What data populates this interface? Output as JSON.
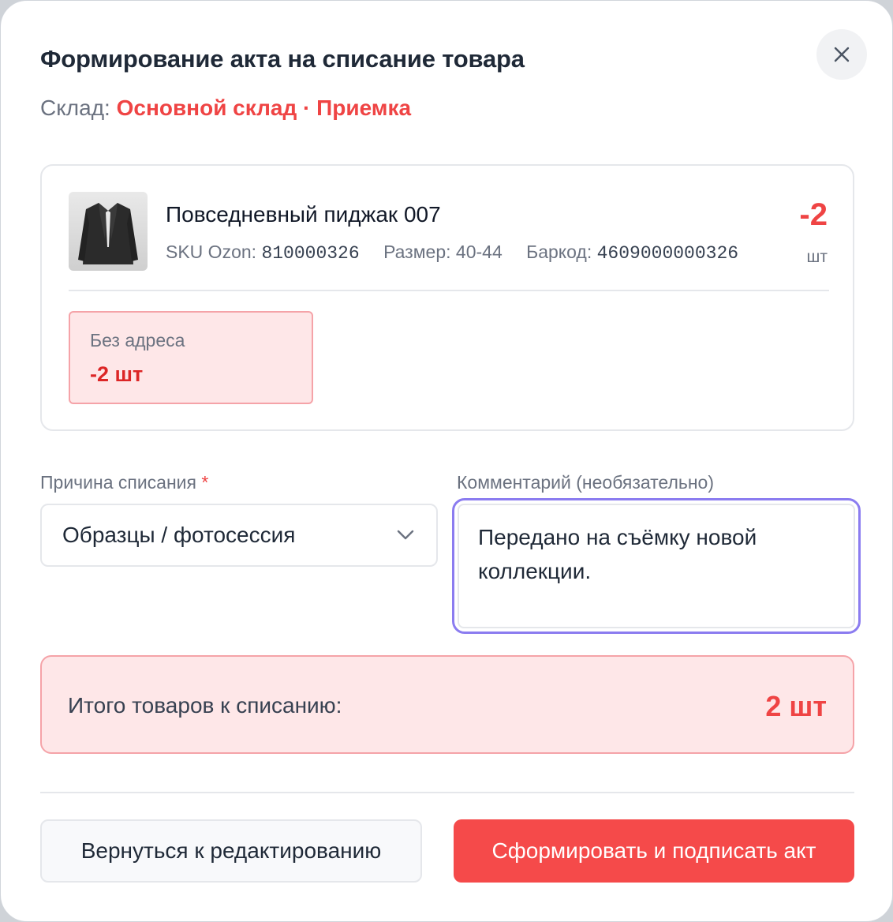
{
  "dialog": {
    "title": "Формирование акта на списание товара",
    "close_icon": "close-icon",
    "warehouse_label": "Склад:",
    "warehouse_value": "Основной склад · Приемка"
  },
  "product": {
    "name": "Повседневный пиджак 007",
    "image_icon": "jacket-thumbnail",
    "sku_label": "SKU Ozon:",
    "sku_value": "810000326",
    "size_label": "Размер:",
    "size_value": "40-44",
    "barcode_label": "Баркод:",
    "barcode_value": "4609000000326",
    "quantity": "-2",
    "quantity_unit": "шт",
    "address": {
      "label": "Без адреса",
      "quantity": "-2 шт"
    }
  },
  "form": {
    "reason_label": "Причина списания",
    "reason_required_mark": "*",
    "reason_value": "Образцы / фотосессия",
    "comment_label": "Комментарий (необязательно)",
    "comment_value": "Передано на съёмку новой коллекции."
  },
  "total": {
    "label": "Итого товаров к списанию:",
    "value": "2 шт"
  },
  "actions": {
    "back_label": "Вернуться к редактированию",
    "submit_label": "Сформировать и подписать акт"
  },
  "colors": {
    "accent_red": "#ef4444",
    "focus_ring": "#8b7cf0",
    "danger_bg": "#fee7e8"
  }
}
